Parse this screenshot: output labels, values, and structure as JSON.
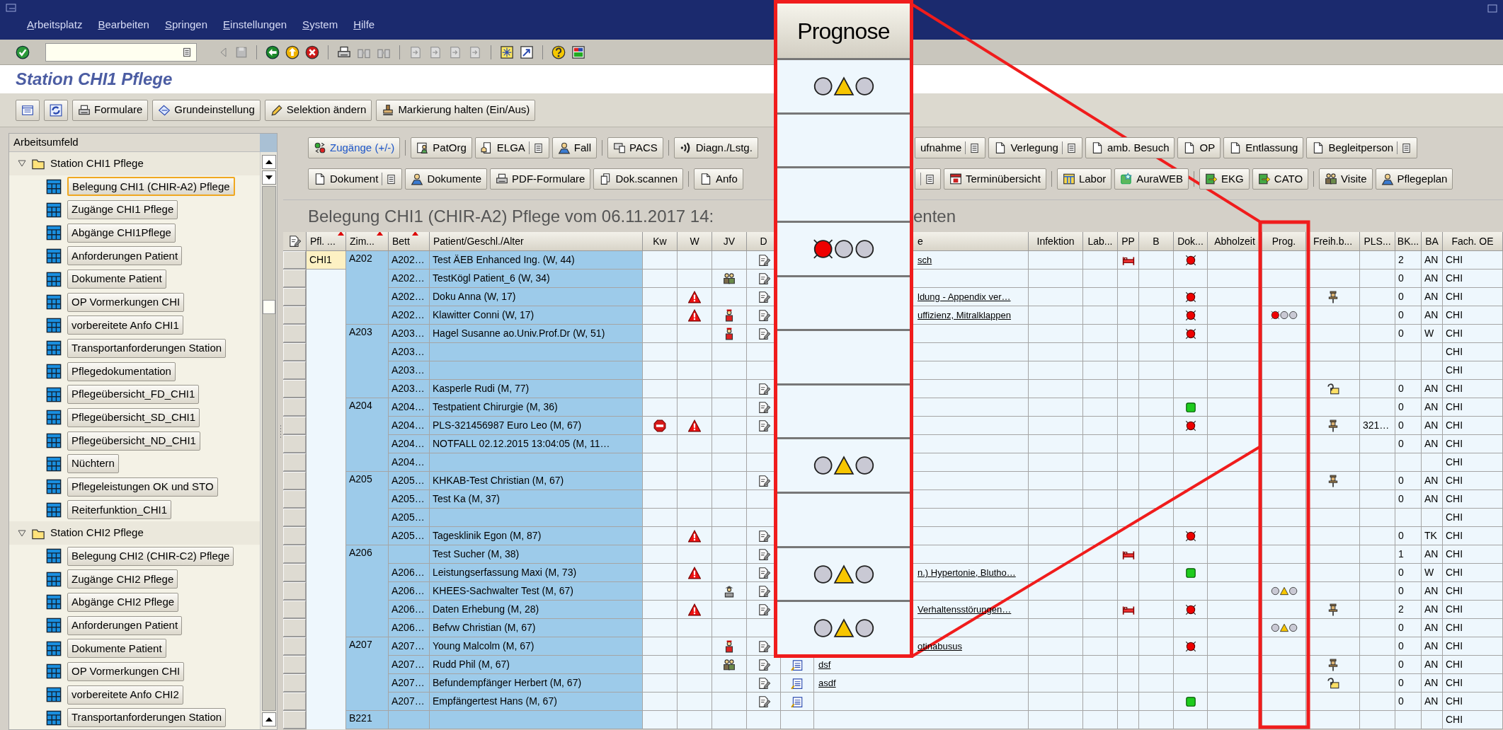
{
  "menu": [
    "Arbeitsplatz",
    "Bearbeiten",
    "Springen",
    "Einstellungen",
    "System",
    "Hilfe"
  ],
  "title": "Station CHI1 Pflege",
  "app_toolbar": [
    {
      "kind": "listview"
    },
    {
      "kind": "refresh"
    },
    {
      "label": "Formulare",
      "kind": "print"
    },
    {
      "label": "Grundeinstellung",
      "kind": "eraser"
    },
    {
      "label": "Selektion ändern",
      "kind": "pencil"
    },
    {
      "label": "Markierung halten (Ein/Aus)",
      "kind": "stamp"
    }
  ],
  "sidebar": {
    "header": "Arbeitsumfeld",
    "folders": [
      {
        "label": "Station CHI1 Pflege",
        "expanded": true,
        "children": [
          {
            "label": "Belegung CHI1 (CHIR-A2) Pflege",
            "selected": true
          },
          {
            "label": "Zugänge CHI1 Pflege",
            "selected": false
          },
          {
            "label": "Abgänge CHI1Pflege",
            "selected": false
          },
          {
            "label": "Anforderungen Patient",
            "selected": false
          },
          {
            "label": "Dokumente Patient",
            "selected": false
          },
          {
            "label": "OP Vormerkungen CHI",
            "selected": false
          },
          {
            "label": "vorbereitete Anfo CHI1",
            "selected": false
          },
          {
            "label": "Transportanforderungen Station",
            "selected": false
          },
          {
            "label": "Pflegedokumentation",
            "selected": false
          },
          {
            "label": "Pflegeübersicht_FD_CHI1",
            "selected": false
          },
          {
            "label": "Pflegeübersicht_SD_CHI1",
            "selected": false
          },
          {
            "label": "Pflegeübersicht_ND_CHI1",
            "selected": false
          },
          {
            "label": "Nüchtern",
            "selected": false
          },
          {
            "label": "Pflegeleistungen OK und STO",
            "selected": false
          },
          {
            "label": "Reiterfunktion_CHI1",
            "selected": false
          }
        ]
      },
      {
        "label": "Station CHI2 Pflege",
        "expanded": true,
        "children": [
          {
            "label": "Belegung CHI2 (CHIR-C2) Pflege",
            "selected": false
          },
          {
            "label": "Zugänge CHI2 Pflege",
            "selected": false
          },
          {
            "label": "Abgänge CHI2 Pflege",
            "selected": false
          },
          {
            "label": "Anforderungen Patient",
            "selected": false
          },
          {
            "label": "Dokumente Patient",
            "selected": false
          },
          {
            "label": "OP Vormerkungen CHI",
            "selected": false
          },
          {
            "label": "vorbereitete Anfo CHI2",
            "selected": false
          },
          {
            "label": "Transportanforderungen Station",
            "selected": false
          }
        ]
      }
    ]
  },
  "button_rows": [
    {
      "left": [
        [
          {
            "label": "Zugänge (+/-)",
            "kind": "arrivals",
            "menu": false,
            "emphasized": true
          }
        ],
        [
          {
            "label": "PatOrg",
            "kind": "patorg",
            "menu": false,
            "emphasized": false
          },
          {
            "label": "ELGA",
            "kind": "elga",
            "menu": true,
            "emphasized": false
          },
          {
            "label": "Fall",
            "kind": "person",
            "menu": false,
            "emphasized": false
          }
        ],
        [
          {
            "label": "PACS",
            "kind": "pacs",
            "menu": false,
            "emphasized": false
          }
        ],
        [
          {
            "label": "Diagn./Lstg.",
            "kind": "waves",
            "menu": false,
            "emphasized": false
          }
        ]
      ],
      "right": [
        [
          {
            "label": "ufnahme",
            "menu": true,
            "emphasized": false
          },
          {
            "label": "Verlegung",
            "kind": "page",
            "menu": true,
            "emphasized": false
          },
          {
            "label": "amb. Besuch",
            "kind": "page",
            "menu": false,
            "emphasized": false
          },
          {
            "label": "OP",
            "kind": "page",
            "menu": false,
            "emphasized": false
          },
          {
            "label": "Entlassung",
            "kind": "page",
            "menu": false,
            "emphasized": false
          },
          {
            "label": "Begleitperson",
            "kind": "page",
            "menu": true,
            "emphasized": false
          }
        ]
      ]
    },
    {
      "left": [
        [
          {
            "label": "Dokument",
            "kind": "page",
            "menu": true,
            "emphasized": false
          },
          {
            "label": "Dokumente",
            "kind": "person",
            "menu": false,
            "emphasized": false
          },
          {
            "label": "PDF-Formulare",
            "kind": "print",
            "menu": false,
            "emphasized": false
          },
          {
            "label": "Dok.scannen",
            "kind": "scan",
            "menu": false,
            "emphasized": false
          }
        ],
        [
          {
            "label": "Anfo",
            "kind": "page",
            "menu": false,
            "emphasized": false
          }
        ]
      ],
      "right": [
        [
          {
            "menu": true,
            "emphasized": false
          },
          {
            "label": "Terminübersicht",
            "kind": "calendar",
            "menu": false,
            "emphasized": false
          }
        ],
        [
          {
            "label": "Labor",
            "kind": "table",
            "menu": false,
            "emphasized": false
          },
          {
            "label": "AuraWEB",
            "kind": "aura",
            "menu": false,
            "emphasized": false
          }
        ],
        [
          {
            "label": "EKG",
            "kind": "arrowin",
            "menu": false,
            "emphasized": false
          },
          {
            "label": "CATO",
            "kind": "arrowin",
            "menu": false,
            "emphasized": false
          }
        ],
        [
          {
            "label": "Visite",
            "kind": "pair",
            "menu": false,
            "emphasized": false
          },
          {
            "label": "Pflegeplan",
            "kind": "person",
            "menu": false,
            "emphasized": false
          }
        ]
      ]
    }
  ],
  "heading": {
    "left": "Belegung CHI1 (CHIR-A2) Pflege vom 06.11.2017 14:",
    "right": "enten"
  },
  "table": {
    "columns": [
      {
        "label": "Pfl. ...",
        "sorted": true
      },
      {
        "label": "Zim...",
        "sorted": true
      },
      {
        "label": "Bett",
        "sorted": true
      },
      {
        "label": "Patient/Geschl./Alter",
        "sorted": false
      },
      {
        "label": "Kw",
        "sorted": false
      },
      {
        "label": "W",
        "sorted": false
      },
      {
        "label": "JV",
        "sorted": false
      },
      {
        "label": "D",
        "sorted": false
      },
      {
        "label": "e",
        "sorted": false
      },
      {
        "label": "Infektion",
        "sorted": false
      },
      {
        "label": "Lab...",
        "sorted": false
      },
      {
        "label": "PP",
        "sorted": false
      },
      {
        "label": "B",
        "sorted": false
      },
      {
        "label": "Dok...",
        "sorted": false
      },
      {
        "label": "Abholzeit",
        "sorted": false
      },
      {
        "label": "Prog.",
        "sorted": false
      },
      {
        "label": "Freih.b...",
        "sorted": false
      },
      {
        "label": "PLS...",
        "sorted": false
      },
      {
        "label": "BK...",
        "sorted": false
      },
      {
        "label": "BA",
        "sorted": false
      },
      {
        "label": "Fach. OE",
        "sorted": false
      }
    ],
    "rows": [
      {
        "pfl": "CHI1",
        "room": "A202",
        "bed": "A202…",
        "patient": "Test ÄEB Enhanced Ing. (W, 44)",
        "d": {
          "kind": "doc"
        },
        "diag": "sch",
        "pp": {
          "kind": "bed"
        },
        "dok": {
          "kind": "red"
        },
        "bk": "2",
        "ba": "AN",
        "oe": "CHI"
      },
      {
        "bed": "A202…",
        "patient": "TestKögl Patient_6 (W, 34)",
        "jv": {
          "kind": "pair"
        },
        "d": {
          "kind": "doc"
        },
        "bk": "0",
        "ba": "AN",
        "oe": "CHI"
      },
      {
        "bed": "A202…",
        "patient": "Doku Anna (W, 17)",
        "w": {
          "kind": "warning"
        },
        "d": {
          "kind": "doc"
        },
        "diag": "ldung - Appendix ver…",
        "dok": {
          "kind": "red"
        },
        "freih": {
          "kind": "pin"
        },
        "bk": "0",
        "ba": "AN",
        "oe": "CHI"
      },
      {
        "bed": "A202…",
        "patient": "Klawitter Conni (W, 17)",
        "w": {
          "kind": "warning"
        },
        "jv": {
          "kind": "guard"
        },
        "d": {
          "kind": "doc"
        },
        "diag": "uffizienz, Mitralklappen",
        "dok": {
          "kind": "red"
        },
        "prog": {
          "kind": "red"
        },
        "bk": "0",
        "ba": "AN",
        "oe": "CHI"
      },
      {
        "room": "A203",
        "bed": "A203…",
        "patient": "Hagel Susanne ao.Univ.Prof.Dr (W, 51)",
        "jv": {
          "kind": "guard"
        },
        "d": {
          "kind": "doc"
        },
        "dok": {
          "kind": "red"
        },
        "bk": "0",
        "ba": "W",
        "oe": "CHI"
      },
      {
        "bed": "A203…",
        "oe": "CHI"
      },
      {
        "bed": "A203…",
        "oe": "CHI"
      },
      {
        "bed": "A203…",
        "patient": "Kasperle Rudi (M, 77)",
        "d": {
          "kind": "doc"
        },
        "freih": {
          "kind": "query"
        },
        "bk": "0",
        "ba": "AN",
        "oe": "CHI"
      },
      {
        "room": "A204",
        "bed": "A204…",
        "patient": "Testpatient Chirurgie (M, 36)",
        "d": {
          "kind": "doc"
        },
        "dok": {
          "kind": "green"
        },
        "bk": "0",
        "ba": "AN",
        "oe": "CHI"
      },
      {
        "bed": "A204…",
        "patient": "PLS-321456987 Euro Leo (M, 67)",
        "kw": {
          "kind": "stop"
        },
        "w": {
          "kind": "warning"
        },
        "d": {
          "kind": "doc"
        },
        "dok": {
          "kind": "red"
        },
        "freih": {
          "kind": "pin"
        },
        "pls": "321…",
        "bk": "0",
        "ba": "AN",
        "oe": "CHI"
      },
      {
        "bed": "A204…",
        "patient": "NOTFALL 02.12.2015 13:04:05 (M, 11…",
        "bk": "0",
        "ba": "AN",
        "oe": "CHI"
      },
      {
        "bed": "A204…",
        "oe": "CHI"
      },
      {
        "room": "A205",
        "bed": "A205…",
        "patient": "KHKAB-Test Christian (M, 67)",
        "d": {
          "kind": "doc"
        },
        "freih": {
          "kind": "pin"
        },
        "bk": "0",
        "ba": "AN",
        "oe": "CHI"
      },
      {
        "bed": "A205…",
        "patient": "Test Ka (M, 37)",
        "bk": "0",
        "ba": "AN",
        "oe": "CHI"
      },
      {
        "bed": "A205…",
        "oe": "CHI"
      },
      {
        "bed": "A205…",
        "patient": "Tagesklinik Egon (M, 87)",
        "w": {
          "kind": "warning"
        },
        "d": {
          "kind": "doc"
        },
        "dok": {
          "kind": "red"
        },
        "bk": "0",
        "ba": "TK",
        "oe": "CHI"
      },
      {
        "room": "A206",
        "patient": "Test Sucher (M, 38)",
        "d": {
          "kind": "doc"
        },
        "pp": {
          "kind": "bed"
        },
        "bk": "1",
        "ba": "AN",
        "oe": "CHI"
      },
      {
        "bed": "A206…",
        "patient": "Leistungserfassung Maxi (M, 73)",
        "w": {
          "kind": "warning"
        },
        "d": {
          "kind": "doc"
        },
        "diag": "n.) Hypertonie, Blutho…",
        "dok": {
          "kind": "green"
        },
        "bk": "0",
        "ba": "W",
        "oe": "CHI"
      },
      {
        "bed": "A206…",
        "patient": "KHEES-Sachwalter Test (M, 67)",
        "jv": {
          "kind": "officer"
        },
        "d": {
          "kind": "doc"
        },
        "prog": {
          "kind": "yellow"
        },
        "bk": "0",
        "ba": "AN",
        "oe": "CHI"
      },
      {
        "bed": "A206…",
        "patient": "Daten Erhebung (M, 28)",
        "w": {
          "kind": "warning"
        },
        "d": {
          "kind": "doc"
        },
        "diag": "Verhaltensstörungen…",
        "pp": {
          "kind": "bed"
        },
        "dok": {
          "kind": "red"
        },
        "freih": {
          "kind": "pin"
        },
        "bk": "2",
        "ba": "AN",
        "oe": "CHI"
      },
      {
        "bed": "A206…",
        "patient": "Befvw Christian (M, 67)",
        "prog": {
          "kind": "yellow"
        },
        "bk": "0",
        "ba": "AN",
        "oe": "CHI"
      },
      {
        "room": "A207",
        "bed": "A207…",
        "patient": "Young Malcolm (M, 67)",
        "jv": {
          "kind": "guard"
        },
        "d": {
          "kind": "doc"
        },
        "diag": "otinabusus",
        "dok": {
          "kind": "red"
        },
        "bk": "0",
        "ba": "AN",
        "oe": "CHI"
      },
      {
        "bed": "A207…",
        "patient": "Rudd Phil (M, 67)",
        "jv": {
          "kind": "pair"
        },
        "d": {
          "kind": "doc"
        },
        "note": {
          "kind": "notepad"
        },
        "diag": "dsf",
        "freih": {
          "kind": "pin"
        },
        "bk": "0",
        "ba": "AN",
        "oe": "CHI"
      },
      {
        "bed": "A207…",
        "patient": "Befundempfänger Herbert (M, 67)",
        "d": {
          "kind": "doc"
        },
        "note": {
          "kind": "notepad"
        },
        "diag": "asdf",
        "freih": {
          "kind": "query"
        },
        "bk": "0",
        "ba": "AN",
        "oe": "CHI"
      },
      {
        "bed": "A207…",
        "patient": "Empfängertest Hans (M, 67)",
        "d": {
          "kind": "doc"
        },
        "note": {
          "kind": "notepad"
        },
        "dok": {
          "kind": "green"
        },
        "bk": "0",
        "ba": "AN",
        "oe": "CHI"
      },
      {
        "room": "B221",
        "oe": "CHI"
      }
    ]
  },
  "callout": {
    "header": "Prognose",
    "cells": [
      {
        "kind": "yellow"
      },
      {
        "kind": "none"
      },
      {
        "kind": "none"
      },
      {
        "kind": "red"
      },
      {
        "kind": "none"
      },
      {
        "kind": "none"
      },
      {
        "kind": "none"
      },
      {
        "kind": "yellow"
      },
      {
        "kind": "none"
      },
      {
        "kind": "yellow"
      },
      {
        "kind": "yellow"
      }
    ]
  }
}
